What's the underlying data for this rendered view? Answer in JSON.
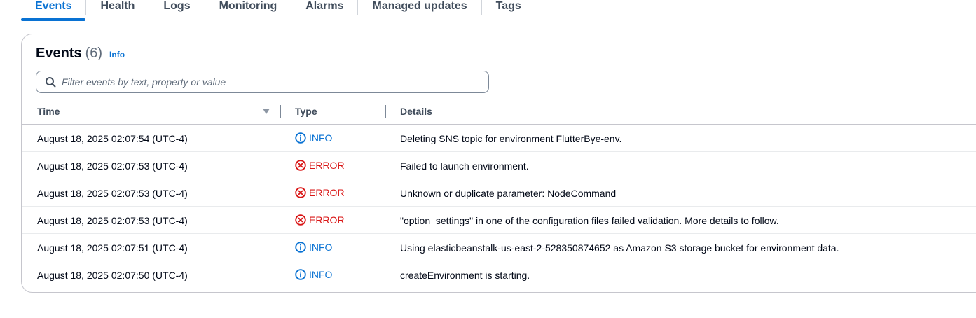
{
  "tabs": [
    {
      "label": "Events",
      "active": true
    },
    {
      "label": "Health",
      "active": false
    },
    {
      "label": "Logs",
      "active": false
    },
    {
      "label": "Monitoring",
      "active": false
    },
    {
      "label": "Alarms",
      "active": false
    },
    {
      "label": "Managed updates",
      "active": false
    },
    {
      "label": "Tags",
      "active": false
    }
  ],
  "events_panel": {
    "title": "Events",
    "count": "(6)",
    "info_link": "Info",
    "filter_placeholder": "Filter events by text, property or value",
    "filter_value": ""
  },
  "table": {
    "columns": [
      "Time",
      "Type",
      "Details"
    ],
    "rows": [
      {
        "time": "August 18, 2025 02:07:54 (UTC-4)",
        "type": "INFO",
        "details": "Deleting SNS topic for environment FlutterBye-env."
      },
      {
        "time": "August 18, 2025 02:07:53 (UTC-4)",
        "type": "ERROR",
        "details": "Failed to launch environment."
      },
      {
        "time": "August 18, 2025 02:07:53 (UTC-4)",
        "type": "ERROR",
        "details": "Unknown or duplicate parameter: NodeCommand"
      },
      {
        "time": "August 18, 2025 02:07:53 (UTC-4)",
        "type": "ERROR",
        "details": "\"option_settings\" in one of the configuration files failed validation. More details to follow."
      },
      {
        "time": "August 18, 2025 02:07:51 (UTC-4)",
        "type": "INFO",
        "details": "Using elasticbeanstalk-us-east-2-528350874652 as Amazon S3 storage bucket for environment data."
      },
      {
        "time": "August 18, 2025 02:07:50 (UTC-4)",
        "type": "INFO",
        "details": "createEnvironment is starting."
      }
    ]
  },
  "colors": {
    "accent": "#0972d3",
    "info": "#0972d3",
    "error": "#d91515"
  },
  "icons": {
    "info": "info-circle-icon",
    "error": "error-circle-x-icon",
    "search": "search-icon",
    "sort": "sort-descending-icon"
  }
}
